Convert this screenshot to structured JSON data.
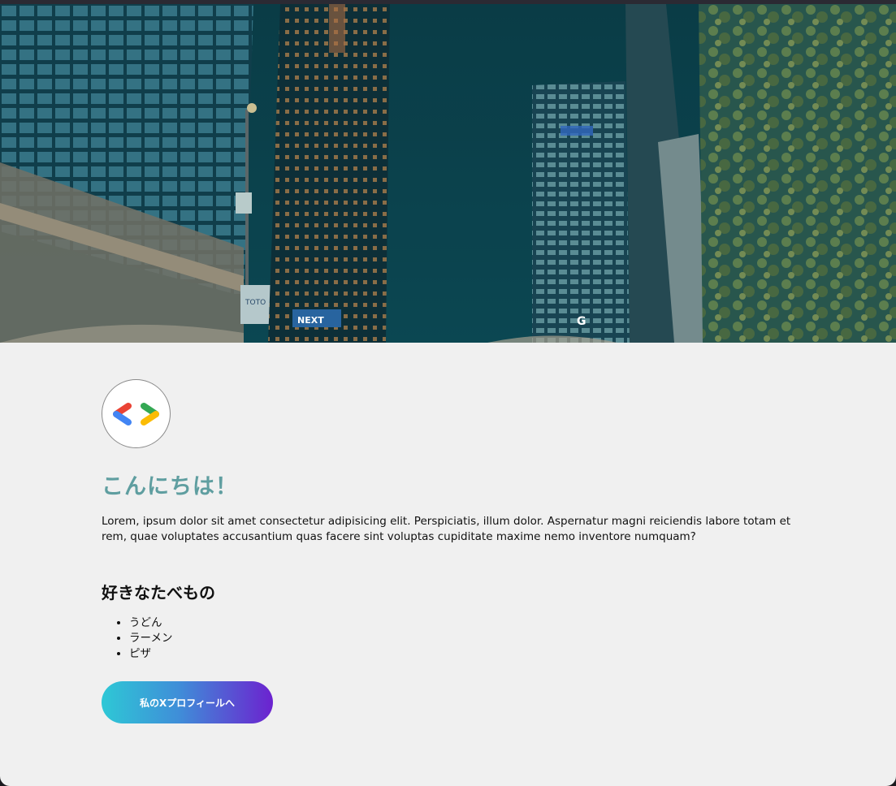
{
  "profile": {
    "greeting": "こんにちは！",
    "intro": "Lorem, ipsum dolor sit amet consectetur adipisicing elit. Perspiciatis, illum dolor. Aspernatur magni reiciendis labore totam et rem, quae voluptates accusantium quas facere sint voluptas cupiditate maxime nemo inventore numquam?"
  },
  "hero": {
    "sign_text": "NEXT",
    "building_sign": "G",
    "kiosk_text": "TOTO"
  },
  "foods": {
    "title": "好きなたべもの",
    "items": [
      "うどん",
      "ラーメン",
      "ピザ"
    ]
  },
  "cta": {
    "label": "私のXプロフィールへ"
  },
  "colors": {
    "greeting": "#5f9ea0",
    "card_bg": "#f0f0f0",
    "cta_gradient_start": "#2ec8d6",
    "cta_gradient_end": "#6c22cf",
    "logo_blue": "#4285f4",
    "logo_red": "#ea4335",
    "logo_green": "#34a853",
    "logo_yellow": "#fbbc04"
  },
  "icons": {
    "avatar": "developer-code-brackets-icon"
  }
}
